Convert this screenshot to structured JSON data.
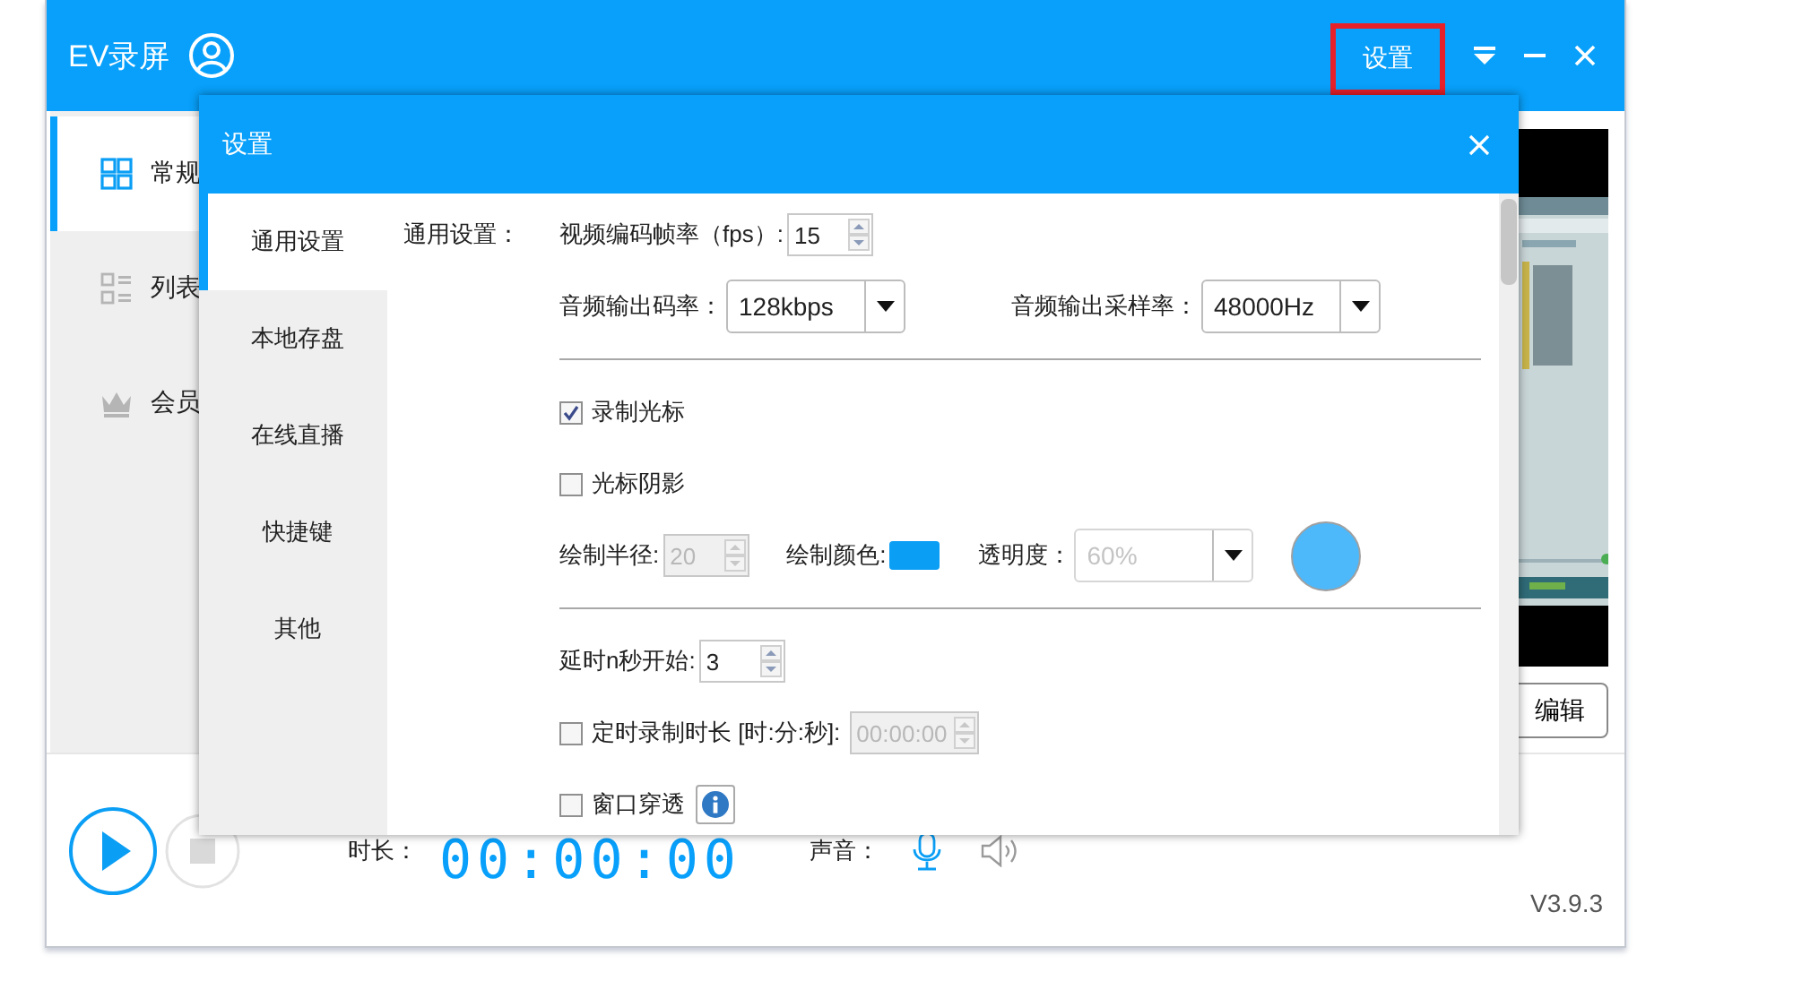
{
  "title_bar": {
    "title": "EV录屏",
    "settings_button": "设置",
    "settings_highlighted": true
  },
  "sidebar": {
    "items": [
      {
        "label": "常规",
        "kind": "grid",
        "selected": true
      },
      {
        "label": "列表",
        "kind": "list",
        "selected": false
      },
      {
        "label": "会员",
        "kind": "crown",
        "selected": false
      }
    ]
  },
  "preview": {
    "kind": "picture",
    "edit_button": "编辑"
  },
  "bottom_bar": {
    "duration_label": "时长：",
    "timer": "00:00:00",
    "sound_label": "声音：",
    "version": "V3.9.3"
  },
  "dialog": {
    "title": "设置",
    "nav": [
      {
        "label": "通用设置",
        "selected": true
      },
      {
        "label": "本地存盘",
        "selected": false
      },
      {
        "label": "在线直播",
        "selected": false
      },
      {
        "label": "快捷键",
        "selected": false
      },
      {
        "label": "其他",
        "selected": false
      }
    ],
    "section_label": "通用设置：",
    "rows": [
      {
        "kind": "controls",
        "controls": [
          {
            "kind": "spin",
            "label": "视频编码帧率（fps）:",
            "value": "15",
            "disabled": false
          }
        ]
      },
      {
        "kind": "controls",
        "controls": [
          {
            "kind": "dropdown",
            "label": "音频输出码率：",
            "value": "128kbps",
            "disabled": false
          },
          {
            "kind": "dropdown",
            "label": "音频输出采样率：",
            "value": "48000Hz",
            "disabled": false
          }
        ]
      },
      {
        "kind": "separator"
      },
      {
        "kind": "controls",
        "controls": [
          {
            "kind": "checkbox",
            "label": "录制光标",
            "checked": true
          }
        ]
      },
      {
        "kind": "controls",
        "controls": [
          {
            "kind": "checkbox",
            "label": "光标阴影",
            "checked": false
          }
        ]
      },
      {
        "kind": "controls",
        "controls": [
          {
            "kind": "spin",
            "label": "绘制半径:",
            "value": "20",
            "disabled": true
          },
          {
            "kind": "color",
            "label": "绘制颜色:",
            "color": "#0a9ef5"
          },
          {
            "kind": "dropdown",
            "label": "透明度：",
            "value": "60%",
            "disabled": true
          },
          {
            "kind": "dot",
            "color": "#4db8fa"
          }
        ]
      },
      {
        "kind": "separator"
      },
      {
        "kind": "controls",
        "controls": [
          {
            "kind": "spin",
            "label": "延时n秒开始:",
            "value": "3",
            "disabled": false
          }
        ]
      },
      {
        "kind": "controls",
        "controls": [
          {
            "kind": "checkbox",
            "label": "定时录制时长 [时:分:秒]:",
            "checked": false
          },
          {
            "kind": "spin",
            "value": "00:00:00",
            "disabled": true
          }
        ]
      },
      {
        "kind": "controls",
        "controls": [
          {
            "kind": "checkbox",
            "label": "窗口穿透",
            "checked": false
          },
          {
            "kind": "info"
          }
        ]
      }
    ]
  }
}
